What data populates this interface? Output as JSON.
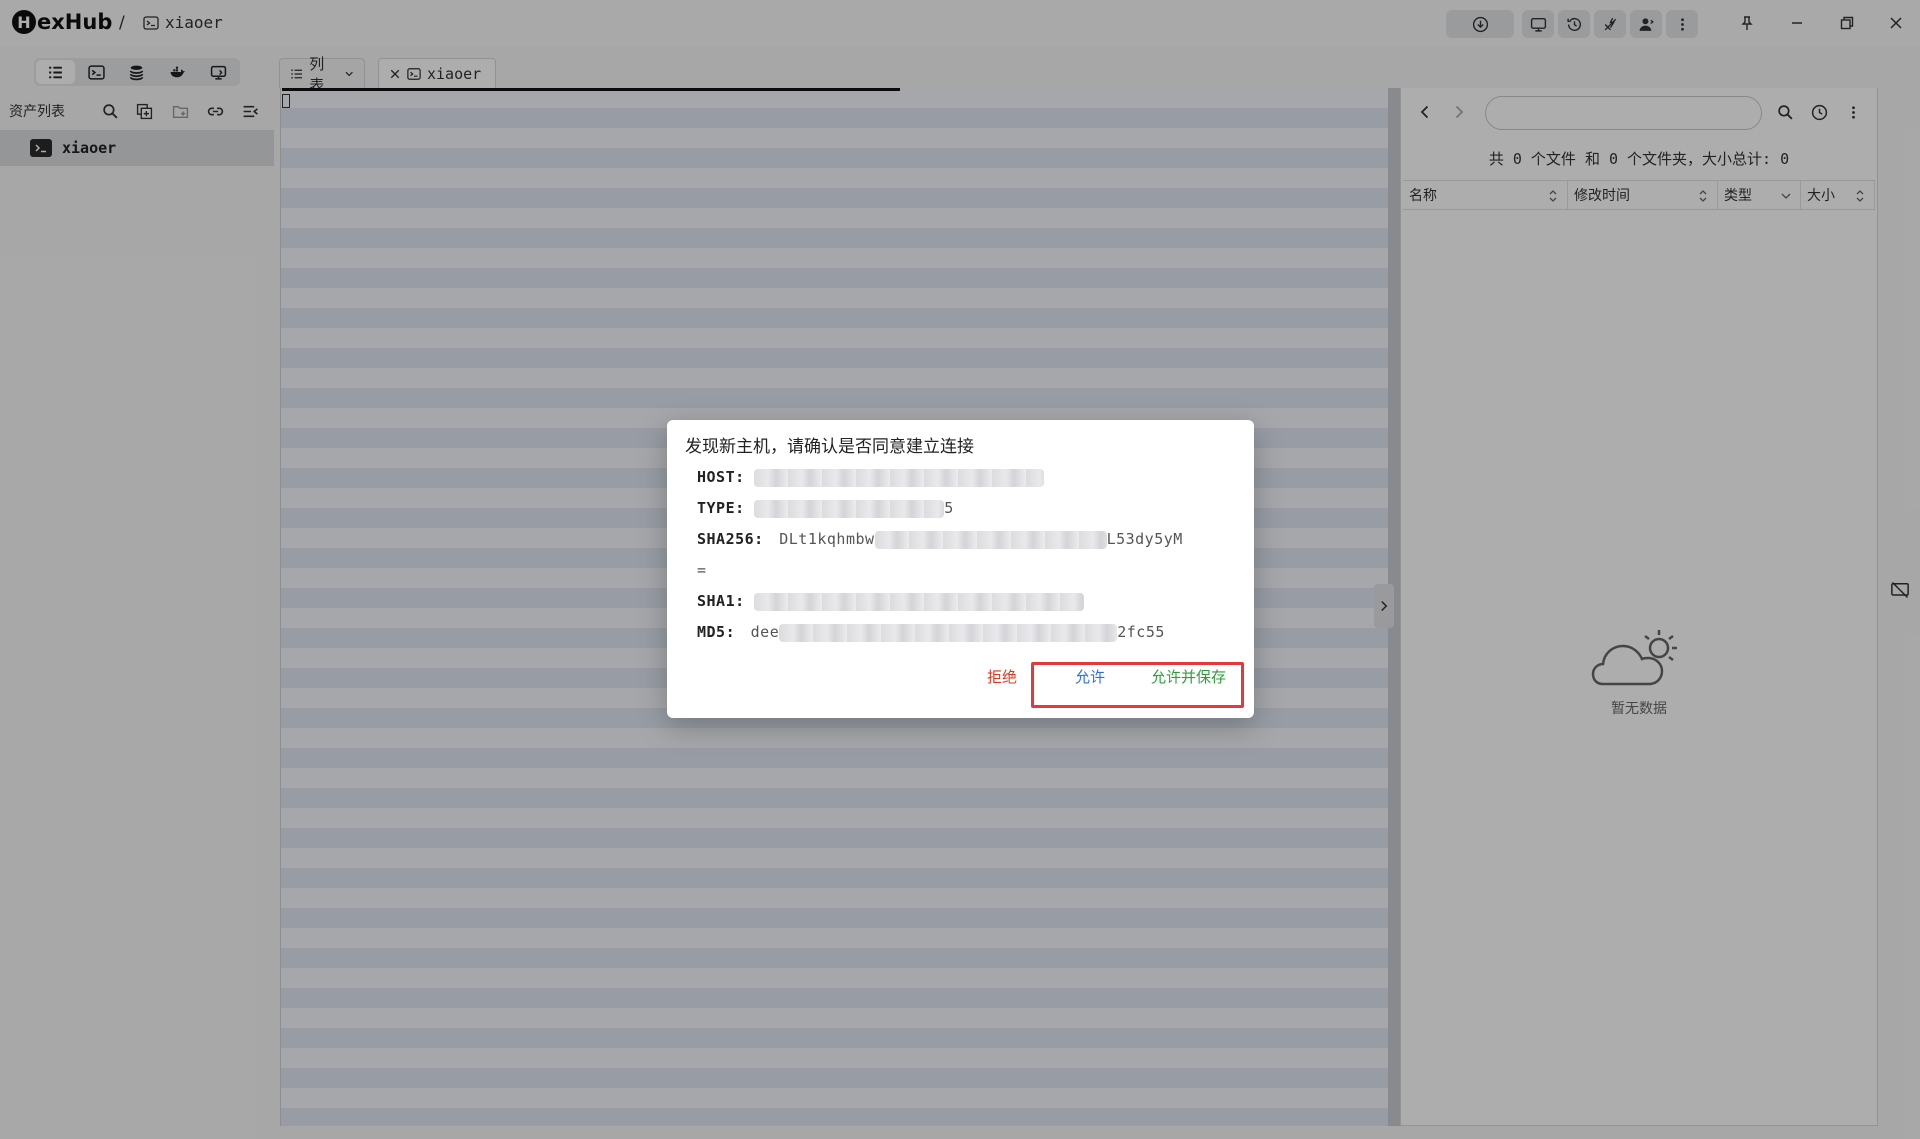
{
  "app": {
    "logo_letter": "H",
    "logo_rest": "exHub",
    "breadcrumb_sep": "/",
    "breadcrumb_current": "xiaoer"
  },
  "sidebar": {
    "title": "资产列表",
    "items": [
      {
        "label": "xiaoer"
      }
    ]
  },
  "tabs": [
    {
      "label": "列表"
    },
    {
      "label": "xiaoer"
    }
  ],
  "file_panel": {
    "path_value": "",
    "summary": "共 0 个文件 和 0 个文件夹，大小总计: 0",
    "columns": [
      "名称",
      "修改时间",
      "类型",
      "大小"
    ],
    "empty_text": "暂无数据"
  },
  "dialog": {
    "title": "发现新主机，请确认是否同意建立连接",
    "host_label": "HOST:",
    "type_label": "TYPE:",
    "type_visible": "5",
    "sha256_label": "SHA256:",
    "sha256_visible_start": "DLt1kqhmbw",
    "sha256_visible_end": "L53dy5yM",
    "sha256_wrap": "=",
    "sha1_label": "SHA1:",
    "md5_label": "MD5:",
    "md5_visible_start": "dee",
    "md5_visible_end": "2fc55",
    "reject_label": "拒绝",
    "allow_label": "允许",
    "allow_save_label": "允许并保存"
  },
  "colors": {
    "reject": "#d9381e",
    "allow": "#2f6fe0",
    "allow_save": "#2e9e3b",
    "highlight": "#e4393c"
  }
}
